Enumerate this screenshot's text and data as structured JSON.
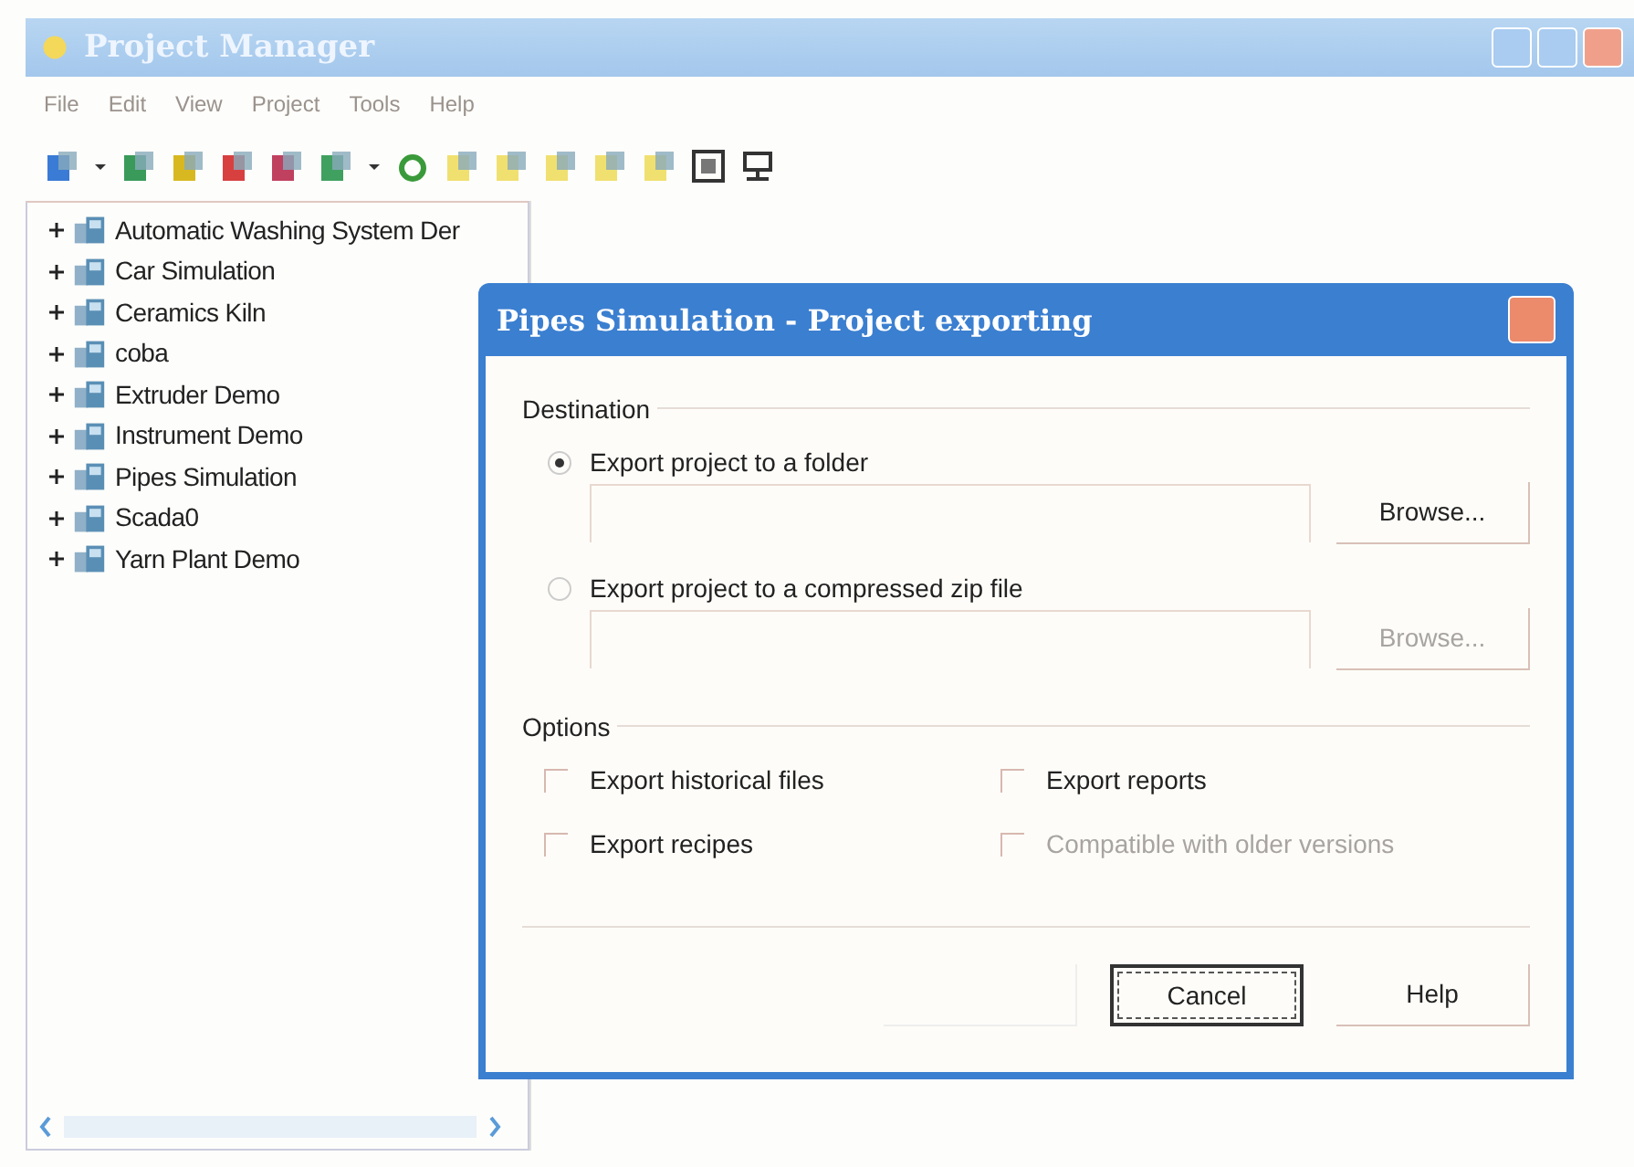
{
  "window": {
    "title": "Project Manager"
  },
  "menu": [
    "File",
    "Edit",
    "View",
    "Project",
    "Tools",
    "Help"
  ],
  "tree": [
    {
      "label": "Automatic Washing System Der",
      "expanded": false
    },
    {
      "label": "Car Simulation",
      "expanded": false
    },
    {
      "label": "Ceramics Kiln",
      "expanded": false
    },
    {
      "label": "coba",
      "expanded": false
    },
    {
      "label": "Extruder Demo",
      "expanded": false
    },
    {
      "label": "Instrument Demo",
      "expanded": false
    },
    {
      "label": "Pipes Simulation",
      "expanded": false
    },
    {
      "label": "Scada0",
      "expanded": false
    },
    {
      "label": "Yarn Plant Demo",
      "expanded": false
    }
  ],
  "dialog": {
    "title": "Pipes Simulation - Project exporting",
    "destination": {
      "label": "Destination",
      "choices": [
        {
          "label": "Export project to a folder",
          "selected": true,
          "browse": {
            "label": "Browse...",
            "disabled": false
          }
        },
        {
          "label": "Export project to a compressed zip file",
          "selected": false,
          "browse": {
            "label": "Browse...",
            "disabled": true
          }
        }
      ]
    },
    "options": {
      "label": "Options",
      "checkboxes": [
        {
          "label": "Export historical files",
          "checked": false,
          "disabled": false
        },
        {
          "label": "Export reports",
          "checked": false,
          "disabled": false
        },
        {
          "label": "Export recipes",
          "checked": false,
          "disabled": false
        },
        {
          "label": "Compatible with older versions",
          "checked": false,
          "disabled": true
        }
      ]
    },
    "buttons": [
      {
        "disabled": true
      },
      {
        "label": "Cancel",
        "disabled": false,
        "focused": true
      },
      {
        "label": "Help",
        "disabled": false,
        "focused": false
      }
    ]
  }
}
